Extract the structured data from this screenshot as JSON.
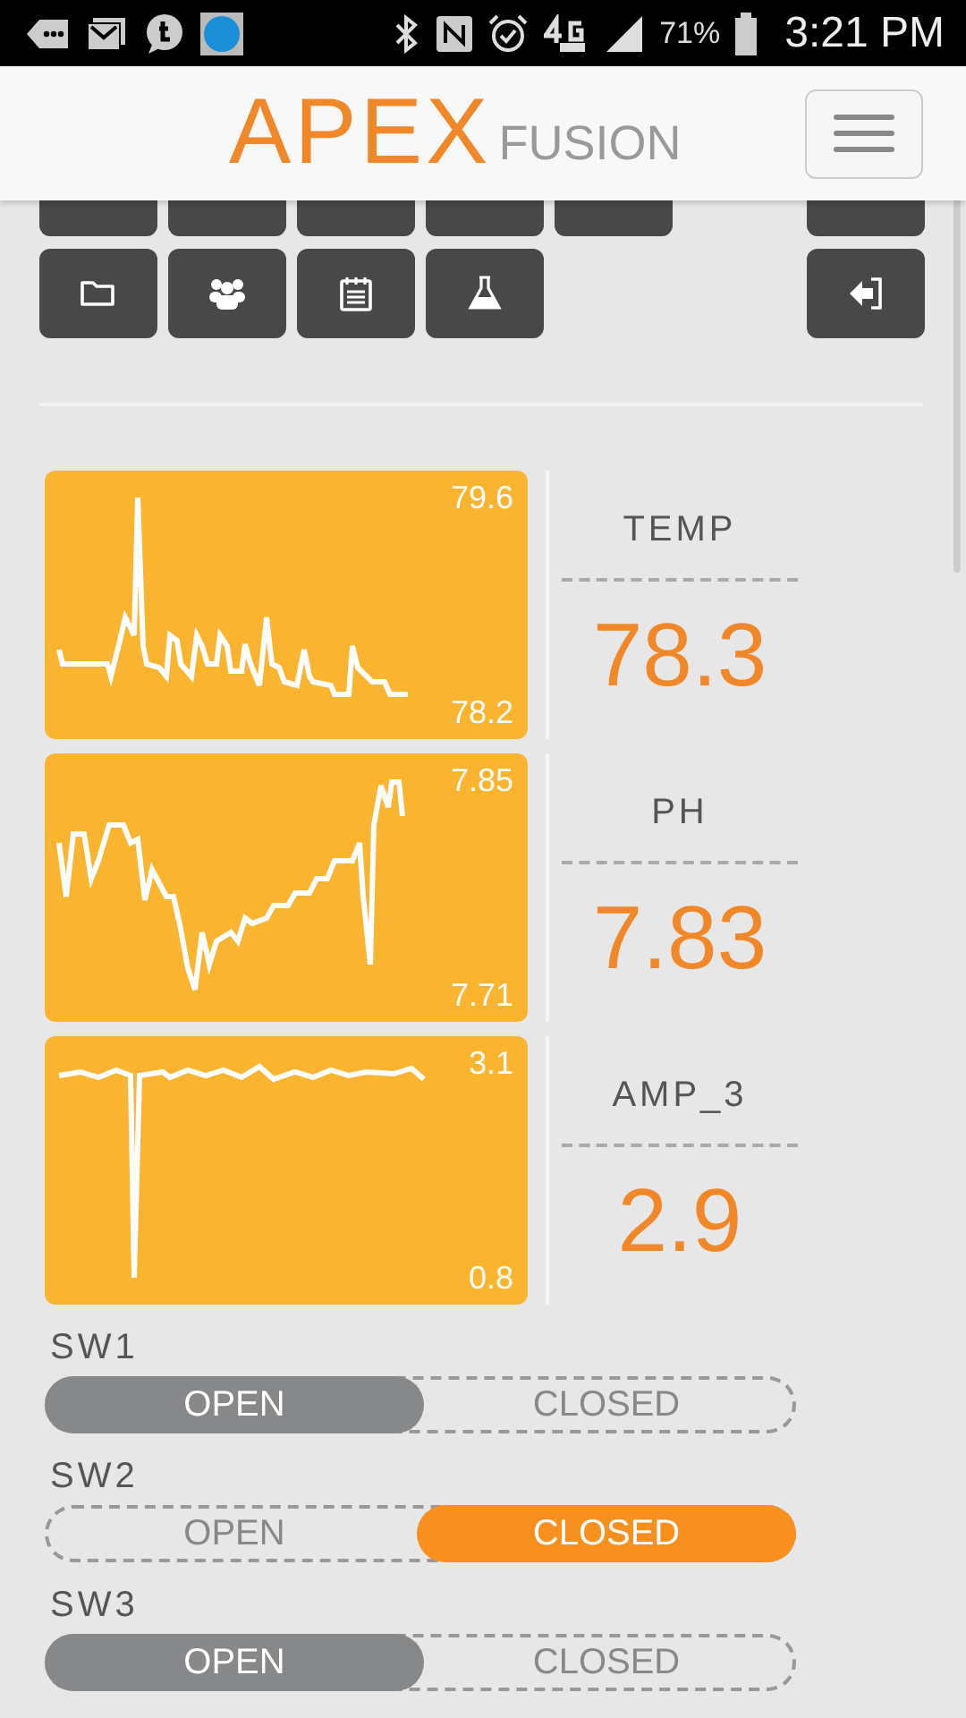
{
  "status_bar": {
    "battery": "71%",
    "time": "3:21 PM"
  },
  "header": {
    "logo_primary": "APEX",
    "logo_secondary": "FUSION"
  },
  "sensors": [
    {
      "name": "TEMP",
      "value": "78.3",
      "max": "79.6",
      "min": "78.2"
    },
    {
      "name": "PH",
      "value": "7.83",
      "max": "7.85",
      "min": "7.71"
    },
    {
      "name": "AMP_3",
      "value": "2.9",
      "max": "3.1",
      "min": "0.8"
    }
  ],
  "switches": [
    {
      "label": "SW1",
      "options": [
        {
          "label": "OPEN",
          "kind": "open",
          "selected": true
        },
        {
          "label": "CLOSED",
          "kind": "closed",
          "selected": false
        }
      ]
    },
    {
      "label": "SW2",
      "options": [
        {
          "label": "OPEN",
          "kind": "open",
          "selected": false
        },
        {
          "label": "CLOSED",
          "kind": "closed",
          "selected": true
        }
      ]
    },
    {
      "label": "SW3",
      "options": [
        {
          "label": "OPEN",
          "kind": "open",
          "selected": true
        },
        {
          "label": "CLOSED",
          "kind": "closed",
          "selected": false
        }
      ]
    }
  ]
}
